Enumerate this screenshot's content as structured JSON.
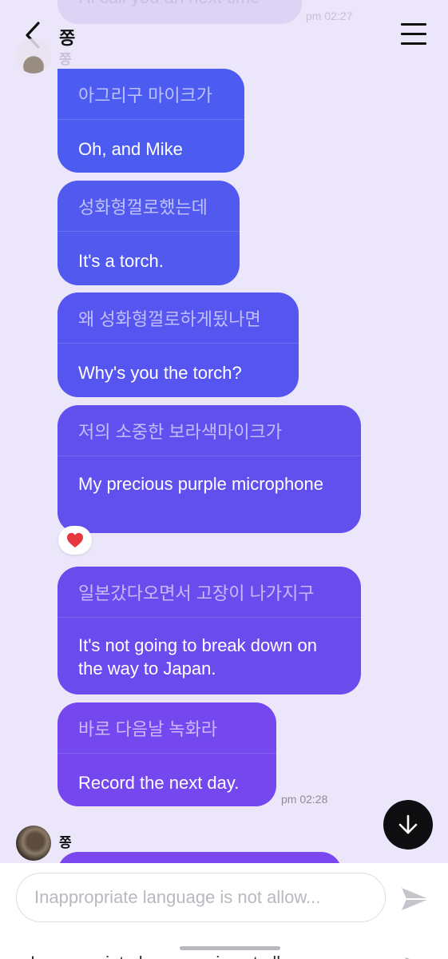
{
  "header": {
    "title": "쫑"
  },
  "previous": {
    "text": "Hi call you an next time",
    "time": "pm 02:27"
  },
  "sender": {
    "name": "쫑"
  },
  "messages": [
    {
      "original": "아그리구 마이크가",
      "translation": "Oh, and Mike"
    },
    {
      "original": "성화형껄로했는데",
      "translation": "It's a torch."
    },
    {
      "original": "왜 성화형껄로하게됬나면",
      "translation": "Why's you the torch?"
    },
    {
      "original": "저의 소중한 보라색마이크가",
      "translation": "My precious purple microphone"
    },
    {
      "original": "일본갔다오면서 고장이 나가지구",
      "translation": "It's not going to break down on the way to Japan."
    },
    {
      "original": "바로 다음날 녹화라",
      "translation": "Record the next day."
    }
  ],
  "reaction": {
    "icon": "heart-icon",
    "color": "#E8383F"
  },
  "last_time": "pm 02:28",
  "next_sender": {
    "name": "쫑"
  },
  "input": {
    "placeholder": "Inappropriate language is not allow...",
    "ghost": "Inappropriate language is not allow"
  },
  "colors": {
    "background": "#ECE6FA",
    "bubble_start": "#4C5CF0",
    "bubble_end": "#7A46EE"
  }
}
